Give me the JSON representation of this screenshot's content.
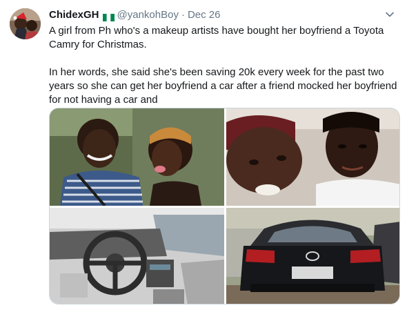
{
  "tweet": {
    "display_name": "ChidexGH",
    "handle": "@yankohBoy",
    "separator": "·",
    "date": "Dec 26",
    "text_paragraph_1": "A girl from Ph who's a makeup artists have bought her boyfriend a Toyota Camry for Christmas.",
    "text_paragraph_2": "In her words, she said she's been saving 20k every week for the past two years so she can get her boyfriend a car after a friend mocked her boyfriend for not having a car and"
  },
  "icons": {
    "flag": "nigeria-flag-icon",
    "menu": "chevron-down-icon"
  },
  "colors": {
    "text": "#14171a",
    "secondary_text": "#657786",
    "flag_green": "#008751",
    "border": "#ccd6dd"
  },
  "media": {
    "count": 4,
    "photos": [
      {
        "content": "couple-selfie-outdoors"
      },
      {
        "content": "couple-selfie-close-up"
      },
      {
        "content": "car-interior-dashboard"
      },
      {
        "content": "black-toyota-camry-rear"
      }
    ]
  }
}
